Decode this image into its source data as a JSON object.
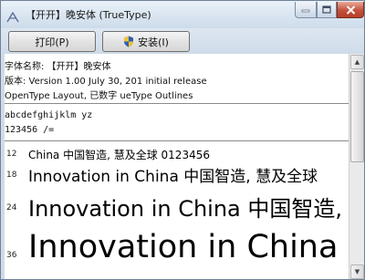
{
  "window": {
    "title": "【开开】晚安体 (TrueType)"
  },
  "toolbar": {
    "print_label": "打印(P)",
    "install_label": "安装(I)"
  },
  "font_info": {
    "name_line": "字体名称: 【开开】晚安体",
    "version_line": "版本: Version 1.00 July 30, 201  initial release",
    "format_line": "OpenType Layout, 已数字    ueType Outlines"
  },
  "samples": {
    "lowercase": "abcdefghijklm             yz",
    "digits": "123456             /="
  },
  "size_rows": [
    {
      "size": "12",
      "text": "      China 中国智造, 慧及全球 0123456"
    },
    {
      "size": "18",
      "text": "Innovation in China 中国智造,  慧及全球"
    },
    {
      "size": "24",
      "text": "Innovation in China 中国智造,"
    },
    {
      "size": "36",
      "text": "Innovation in China"
    }
  ],
  "colors": {
    "title_bar": "#cddbea",
    "close_button": "#c4523b",
    "window_frame": "#cfdbe8"
  },
  "icons": {
    "app": "font-viewer-icon",
    "install": "uac-shield-icon",
    "minimize": "minimize-icon",
    "maximize": "maximize-icon",
    "close": "close-icon"
  }
}
